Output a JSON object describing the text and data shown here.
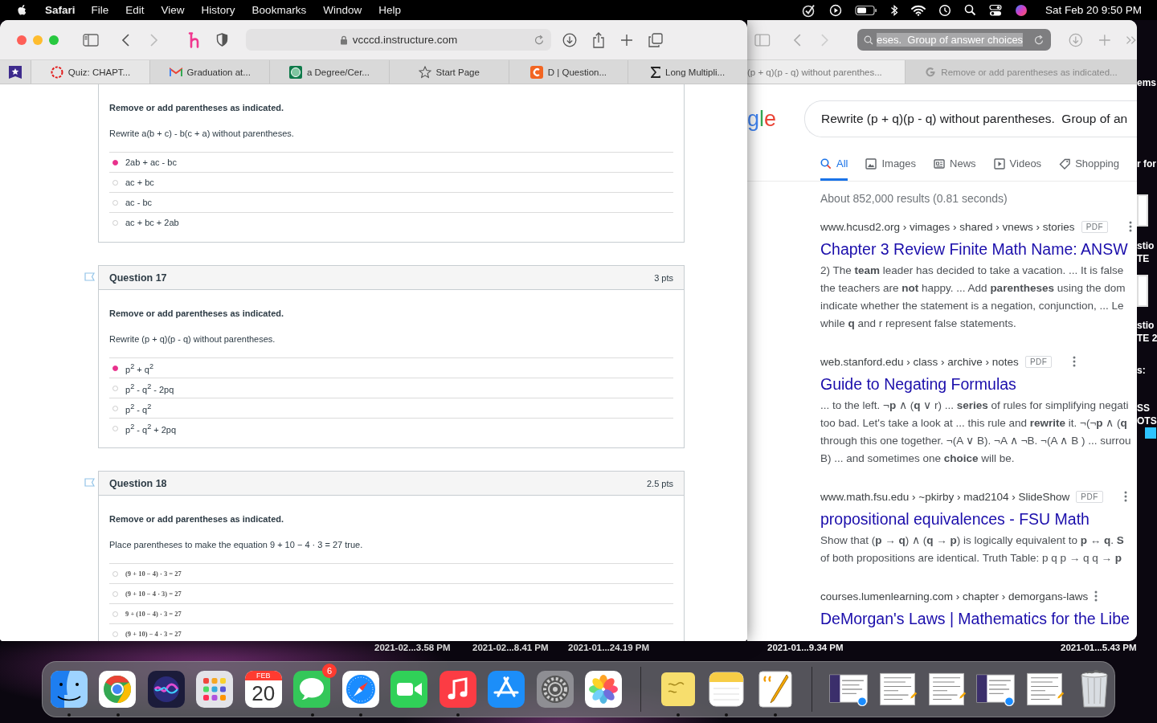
{
  "menu_bar": {
    "app": "Safari",
    "menus": [
      "File",
      "Edit",
      "View",
      "History",
      "Bookmarks",
      "Window",
      "Help"
    ],
    "clock": "Sat Feb 20  9:50 PM"
  },
  "left_window": {
    "address": "vcccd.instructure.com",
    "tabs": [
      {
        "label": "Quiz: CHAPT...",
        "kind": "quiz",
        "selected": true
      },
      {
        "label": "Graduation at...",
        "kind": "mail",
        "selected": false
      },
      {
        "label": "a Degree/Cer...",
        "kind": "globe",
        "selected": false
      },
      {
        "label": "Start Page",
        "kind": "star",
        "selected": false
      },
      {
        "label": "D | Question...",
        "kind": "letter",
        "selected": false
      },
      {
        "label": "Long Multipli...",
        "kind": "sigma",
        "selected": false
      }
    ],
    "questions": [
      {
        "kind": "text",
        "instruction": "Remove or add parentheses as indicated.",
        "prompt": "Rewrite a(b + c) - b(c + a) without parentheses.",
        "answers": [
          {
            "text": "2ab + ac - bc",
            "selected": true
          },
          {
            "text": "ac + bc",
            "selected": false
          },
          {
            "text": "ac - bc",
            "selected": false
          },
          {
            "text": "ac + bc + 2ab",
            "selected": false
          }
        ]
      },
      {
        "kind": "text",
        "title": "Question 17",
        "points": "3 pts",
        "instruction": "Remove or add parentheses as indicated.",
        "prompt": "Rewrite (p + q)(p - q) without parentheses.",
        "answers": [
          {
            "text": "p$^{2}$ + q$^{2}$",
            "selected": true
          },
          {
            "text": "p$^{2}$ - q$^{2}$ - 2pq",
            "selected": false
          },
          {
            "text": "p$^{2}$ - q$^{2}$",
            "selected": false
          },
          {
            "text": "p$^{2}$ - q$^{2}$ + 2pq",
            "selected": false
          }
        ]
      },
      {
        "kind": "typeset",
        "title": "Question 18",
        "points": "2.5 pts",
        "instruction": "Remove or add parentheses as indicated.",
        "prompt": "Place parentheses to make the equation 9 + 10 − 4 · 3 = 27 true.",
        "answers": [
          {
            "text": "(9 + 10 − 4) · 3 = 27",
            "selected": false
          },
          {
            "text": "(9 + 10 − 4 · 3) = 27",
            "selected": false
          },
          {
            "text": "9 + (10 − 4) · 3 = 27",
            "selected": false
          },
          {
            "text": "(9 + 10) − 4 · 3 = 27",
            "selected": false
          }
        ]
      }
    ]
  },
  "right_window": {
    "address_selection": "eses.  Group of answer choices",
    "tabs": [
      {
        "label": "(p + q)(p - q) without parenthes...",
        "selected": true
      },
      {
        "label": "Remove or add parentheses as indicated...",
        "selected": false
      }
    ],
    "logo_fragment": "gle",
    "search_query": "Rewrite (p + q)(p - q) without parentheses.  Group of an",
    "search_tabs": [
      {
        "label": "All",
        "kind": "search",
        "selected": true
      },
      {
        "label": "Images",
        "kind": "image",
        "selected": false
      },
      {
        "label": "News",
        "kind": "news",
        "selected": false
      },
      {
        "label": "Videos",
        "kind": "video",
        "selected": false
      },
      {
        "label": "Shopping",
        "kind": "tag",
        "selected": false
      }
    ],
    "stats": "About 852,000 results (0.81 seconds)",
    "results": [
      {
        "breadcrumb": "www.hcusd2.org › vimages › shared › vnews › stories",
        "badge": "PDF",
        "title": "Chapter 3 Review Finite Math Name: ANSW",
        "snippet": [
          "2) The **team** leader has decided to take a vacation. ... It is false",
          "the teachers are **not** happy. ... Add **parentheses** using the dom",
          "indicate whether the statement is a negation, conjunction, ... Le",
          "while **q** and r represent false statements."
        ]
      },
      {
        "breadcrumb": "web.stanford.edu › class › archive › notes",
        "badge": "PDF",
        "title": "Guide to Negating Formulas",
        "snippet": [
          "... to the left. ¬**p** ∧ (**q** ∨ r) ... **series** of rules for simplifying negati",
          "too bad. Let's take a look at ... this rule and **rewrite** it. ¬(¬**p** ∧ (**q**",
          "through this one together. ¬(A ∨ B). ¬A ∧ ¬B. ¬(A ∧ B ) ... surrou",
          "B) ... and sometimes one **choice** will be."
        ]
      },
      {
        "breadcrumb": "www.math.fsu.edu › ~pkirby › mad2104 › SlideShow",
        "badge": "PDF",
        "title": "propositional equivalences - FSU Math",
        "snippet": [
          "Show that (**p** → **q**) ∧ (**q** → **p**) is logically equivalent to **p** ↔ **q**. **S**",
          "of both propositions are identical. Truth Table: p q p → q q → **p**"
        ]
      },
      {
        "breadcrumb": "courses.lumenlearning.com › chapter › demorgans-laws",
        "title": "DeMorgan's Laws | Mathematics for the Libe"
      }
    ]
  },
  "desktop_labels_right": [
    "ems",
    "r for",
    "stio",
    "TE",
    "stio",
    "TE 2",
    "s:",
    "SS",
    "OTS"
  ],
  "desktop_labels_bottom": [
    "2021-02...3.58 PM",
    "2021-02...8.41 PM",
    "2021-01...24.19 PM",
    "2021-01...9.34 PM",
    "2021-01...5.43 PM"
  ],
  "dock": {
    "items": [
      {
        "kind": "finder",
        "running": true
      },
      {
        "kind": "chrome",
        "running": true
      },
      {
        "kind": "siri",
        "running": false
      },
      {
        "kind": "launchpad",
        "running": false
      },
      {
        "kind": "calendar",
        "running": false,
        "month": "FEB",
        "day": "20"
      },
      {
        "kind": "messages",
        "running": true,
        "badge": "6"
      },
      {
        "kind": "safari",
        "running": true
      },
      {
        "kind": "facetime",
        "running": false
      },
      {
        "kind": "music",
        "running": true
      },
      {
        "kind": "appstore",
        "running": false
      },
      {
        "kind": "settings",
        "running": false
      },
      {
        "kind": "photos",
        "running": false
      },
      {
        "kind": "separator"
      },
      {
        "kind": "stickies",
        "running": true
      },
      {
        "kind": "notes",
        "running": true
      },
      {
        "kind": "textedit",
        "running": true
      },
      {
        "kind": "separator"
      },
      {
        "kind": "doc-web",
        "running": false
      },
      {
        "kind": "doc-text",
        "running": false
      },
      {
        "kind": "doc-text",
        "running": false
      },
      {
        "kind": "doc-web",
        "running": false
      },
      {
        "kind": "doc-text",
        "running": false
      },
      {
        "kind": "trash",
        "running": false
      }
    ]
  }
}
